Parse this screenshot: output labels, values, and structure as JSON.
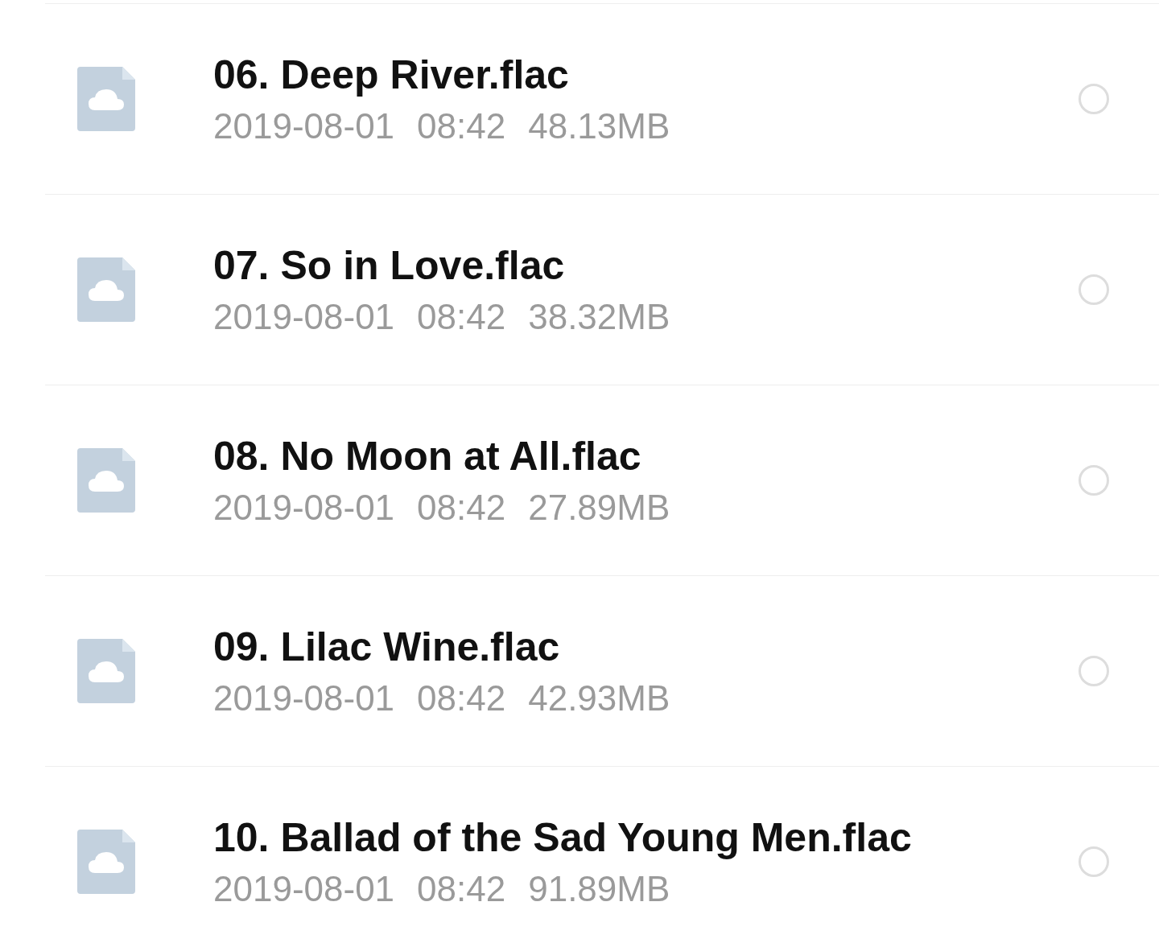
{
  "files": [
    {
      "name": "06. Deep River.flac",
      "date": "2019-08-01",
      "time": "08:42",
      "size": "48.13MB",
      "selected": false
    },
    {
      "name": "07. So in Love.flac",
      "date": "2019-08-01",
      "time": "08:42",
      "size": "38.32MB",
      "selected": false
    },
    {
      "name": "08. No Moon at All.flac",
      "date": "2019-08-01",
      "time": "08:42",
      "size": "27.89MB",
      "selected": false
    },
    {
      "name": "09. Lilac Wine.flac",
      "date": "2019-08-01",
      "time": "08:42",
      "size": "42.93MB",
      "selected": false
    },
    {
      "name": "10. Ballad of the Sad Young Men.flac",
      "date": "2019-08-01",
      "time": "08:42",
      "size": "91.89MB",
      "selected": false
    }
  ]
}
